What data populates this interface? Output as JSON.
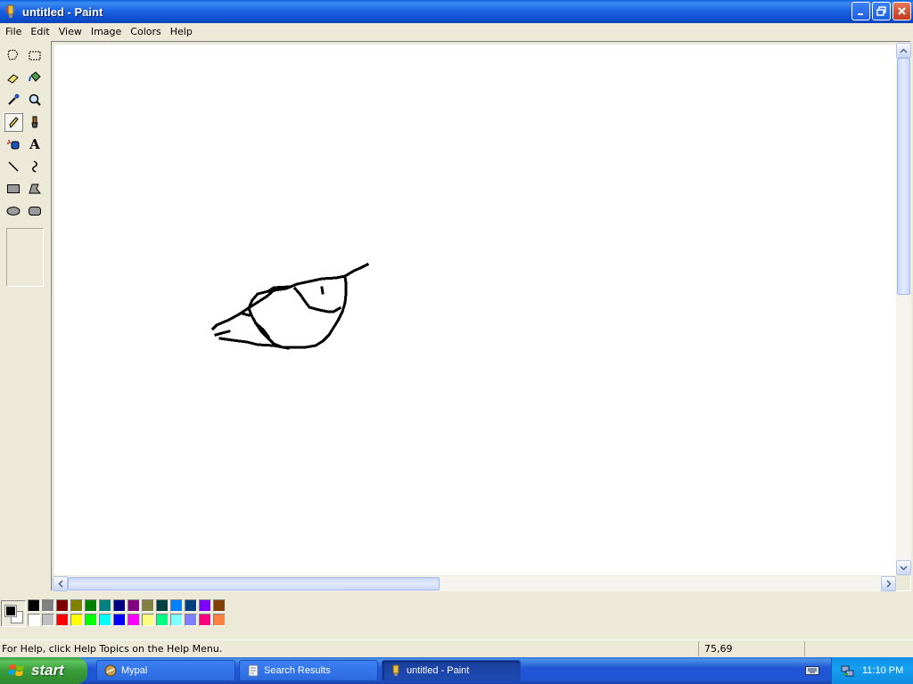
{
  "window": {
    "title": "untitled - Paint"
  },
  "menu": [
    "File",
    "Edit",
    "View",
    "Image",
    "Colors",
    "Help"
  ],
  "tools": [
    {
      "name": "free-form-select-tool",
      "icon": "free-form-select-icon"
    },
    {
      "name": "select-tool",
      "icon": "rect-select-icon"
    },
    {
      "name": "eraser-tool",
      "icon": "eraser-icon"
    },
    {
      "name": "fill-tool",
      "icon": "paint-bucket-icon"
    },
    {
      "name": "pick-color-tool",
      "icon": "eyedropper-icon"
    },
    {
      "name": "magnifier-tool",
      "icon": "magnifier-icon"
    },
    {
      "name": "pencil-tool",
      "icon": "pencil-icon",
      "active": true
    },
    {
      "name": "brush-tool",
      "icon": "brush-icon"
    },
    {
      "name": "airbrush-tool",
      "icon": "airbrush-icon"
    },
    {
      "name": "text-tool",
      "icon": "text-icon",
      "glyph": "A"
    },
    {
      "name": "line-tool",
      "icon": "line-icon"
    },
    {
      "name": "curve-tool",
      "icon": "curve-icon"
    },
    {
      "name": "rectangle-tool",
      "icon": "rectangle-icon"
    },
    {
      "name": "polygon-tool",
      "icon": "polygon-icon"
    },
    {
      "name": "ellipse-tool",
      "icon": "ellipse-icon"
    },
    {
      "name": "rounded-rectangle-tool",
      "icon": "rounded-rectangle-icon"
    }
  ],
  "palette": {
    "foreground": "#000000",
    "background": "#ffffff",
    "top_row": [
      "#000000",
      "#808080",
      "#800000",
      "#808000",
      "#008000",
      "#008080",
      "#000080",
      "#800080",
      "#808040",
      "#004040",
      "#0080ff",
      "#004080",
      "#8000ff",
      "#804000"
    ],
    "bottom_row": [
      "#ffffff",
      "#c0c0c0",
      "#ff0000",
      "#ffff00",
      "#00ff00",
      "#00ffff",
      "#0000ff",
      "#ff00ff",
      "#ffff80",
      "#00ff80",
      "#80ffff",
      "#8080ff",
      "#ff0080",
      "#ff8040"
    ]
  },
  "status": {
    "help_text": "For Help, click Help Topics on the Help Menu.",
    "coordinates": "75,69"
  },
  "taskbar": {
    "start_label": "start",
    "tasks": [
      {
        "label": "Mypal",
        "icon": "mypal-icon"
      },
      {
        "label": "Search Results",
        "icon": "search-results-icon"
      },
      {
        "label": "untitled - Paint",
        "icon": "paint-icon",
        "active": true
      }
    ],
    "clock": "11:10 PM"
  }
}
